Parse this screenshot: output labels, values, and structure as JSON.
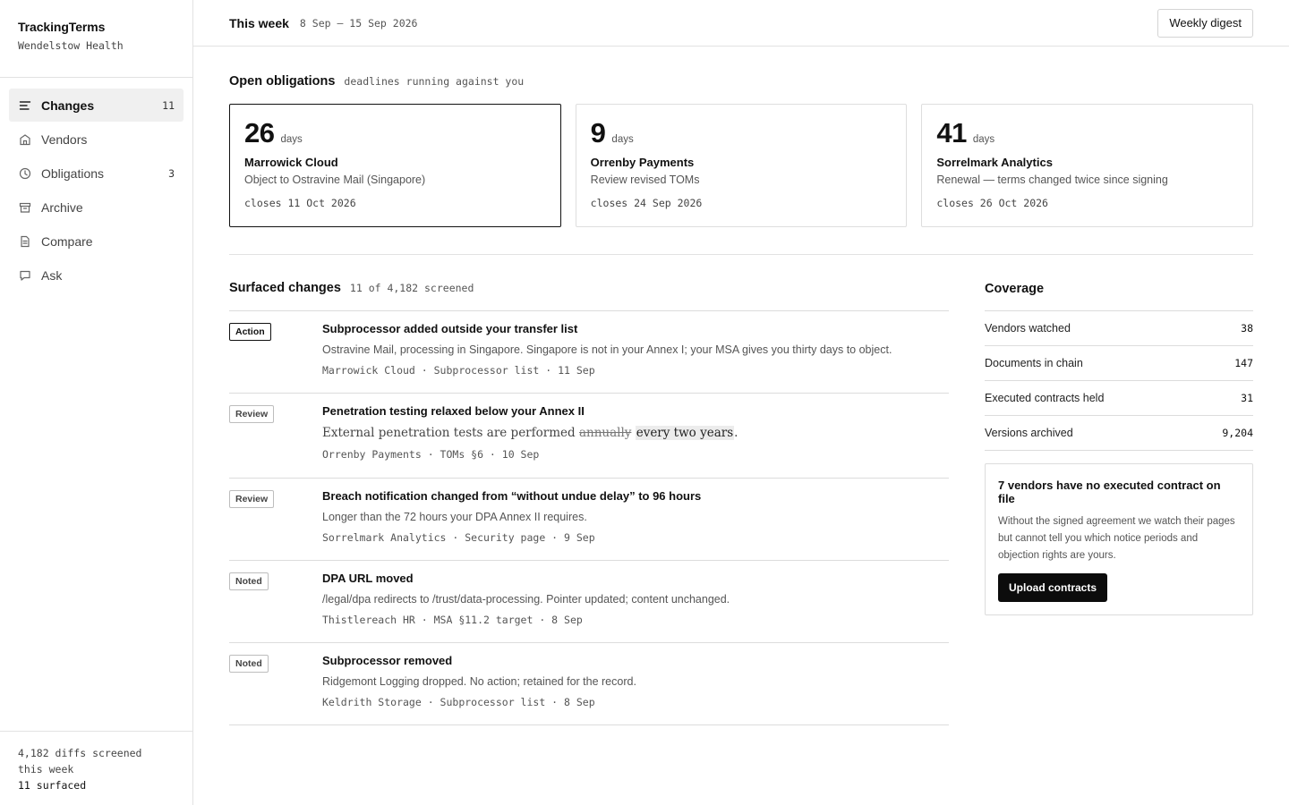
{
  "brand": {
    "name": "TrackingTerms",
    "org": "Wendelstow Health"
  },
  "sidebar": {
    "items": [
      {
        "label": "Changes",
        "count": "11",
        "icon": "lines-icon",
        "active": true
      },
      {
        "label": "Vendors",
        "count": "",
        "icon": "building-icon",
        "active": false
      },
      {
        "label": "Obligations",
        "count": "3",
        "icon": "clock-icon",
        "active": false
      },
      {
        "label": "Archive",
        "count": "",
        "icon": "archive-box-icon",
        "active": false
      },
      {
        "label": "Compare",
        "count": "",
        "icon": "document-compare-icon",
        "active": false
      },
      {
        "label": "Ask",
        "count": "",
        "icon": "chat-bubble-icon",
        "active": false
      }
    ],
    "footer": {
      "line1": "4,182 diffs screened",
      "line2": "this week",
      "line3": "11 surfaced"
    }
  },
  "header": {
    "title": "This week",
    "range": "8 Sep – 15 Sep 2026",
    "button": "Weekly digest"
  },
  "obligations": {
    "title": "Open obligations",
    "subtitle": "deadlines running against you",
    "cards": [
      {
        "days": "26",
        "unit": "days",
        "vendor": "Marrowick Cloud",
        "desc": "Object to Ostravine Mail (Singapore)",
        "closes": "closes 11 Oct 2026",
        "active": true
      },
      {
        "days": "9",
        "unit": "days",
        "vendor": "Orrenby Payments",
        "desc": "Review revised TOMs",
        "closes": "closes 24 Sep 2026",
        "active": false
      },
      {
        "days": "41",
        "unit": "days",
        "vendor": "Sorrelmark Analytics",
        "desc": "Renewal — terms changed twice since signing",
        "closes": "closes 26 Oct 2026",
        "active": false
      }
    ]
  },
  "changes": {
    "title": "Surfaced changes",
    "subtitle": "11 of 4,182 screened",
    "items": [
      {
        "badge": "Action",
        "title": "Subprocessor added outside your transfer list",
        "desc": "Ostravine Mail, processing in Singapore. Singapore is not in your Annex I; your MSA gives you thirty days to object.",
        "meta": "Marrowick Cloud · Subprocessor list · 11 Sep"
      },
      {
        "badge": "Review",
        "title": "Penetration testing relaxed below your Annex II",
        "desc_prefix": "External penetration tests are performed ",
        "desc_deleted": "annually",
        "desc_inserted": "every two years",
        "desc_suffix": ".",
        "meta": "Orrenby Payments · TOMs §6 · 10 Sep"
      },
      {
        "badge": "Review",
        "title": "Breach notification changed from “without undue delay” to 96 hours",
        "desc": "Longer than the 72 hours your DPA Annex II requires.",
        "meta": "Sorrelmark Analytics · Security page · 9 Sep"
      },
      {
        "badge": "Noted",
        "title": "DPA URL moved",
        "desc": "/legal/dpa redirects to /trust/data-processing. Pointer updated; content unchanged.",
        "meta": "Thistlereach HR · MSA §11.2 target · 8 Sep"
      },
      {
        "badge": "Noted",
        "title": "Subprocessor removed",
        "desc": "Ridgemont Logging dropped. No action; retained for the record.",
        "meta": "Keldrith Storage · Subprocessor list · 8 Sep"
      }
    ]
  },
  "coverage": {
    "title": "Coverage",
    "rows": [
      {
        "label": "Vendors watched",
        "value": "38"
      },
      {
        "label": "Documents in chain",
        "value": "147"
      },
      {
        "label": "Executed contracts held",
        "value": "31"
      },
      {
        "label": "Versions archived",
        "value": "9,204"
      }
    ],
    "notice": {
      "title": "7 vendors have no executed contract on file",
      "body": "Without the signed agreement we watch their pages but cannot tell you which notice periods and objection rights are yours.",
      "button": "Upload contracts"
    }
  }
}
